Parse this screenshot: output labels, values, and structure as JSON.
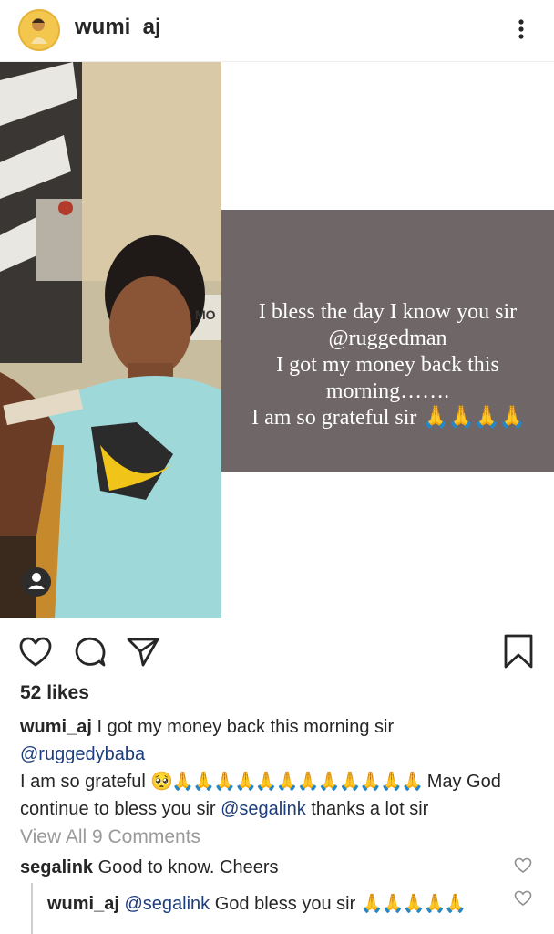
{
  "header": {
    "username": "wumi_aj",
    "more_icon": "more-vertical-icon"
  },
  "post_text": {
    "line1": "I bless the day I know you sir",
    "line2": "@ruggedman",
    "line3": "I got my money back this",
    "line4": "morning…….",
    "line5": "I am so grateful sir",
    "emoji": "🙏🙏🙏🙏"
  },
  "photo": {
    "shirt_text": "MO"
  },
  "actions": {
    "like_icon": "heart-icon",
    "comment_icon": "comment-icon",
    "share_icon": "send-icon",
    "save_icon": "bookmark-icon"
  },
  "likes": "52 likes",
  "caption": {
    "user": "wumi_aj",
    "text1": "I got my money back this morning sir",
    "mention1": "@ruggedybaba",
    "text2": "I am so grateful",
    "emoji": "🥺🙏🙏🙏🙏🙏🙏🙏🙏🙏🙏🙏🙏",
    "text3": "May God continue to bless you sir",
    "mention2": "@segalink",
    "text4": "thanks a lot sir"
  },
  "view_all": "View All 9 Comments",
  "comments": [
    {
      "user": "segalink",
      "text": "Good to know. Cheers"
    },
    {
      "user": "wumi_aj",
      "mention": "@segalink",
      "text": "God bless you sir",
      "emoji": "🙏🙏🙏🙏🙏"
    }
  ]
}
